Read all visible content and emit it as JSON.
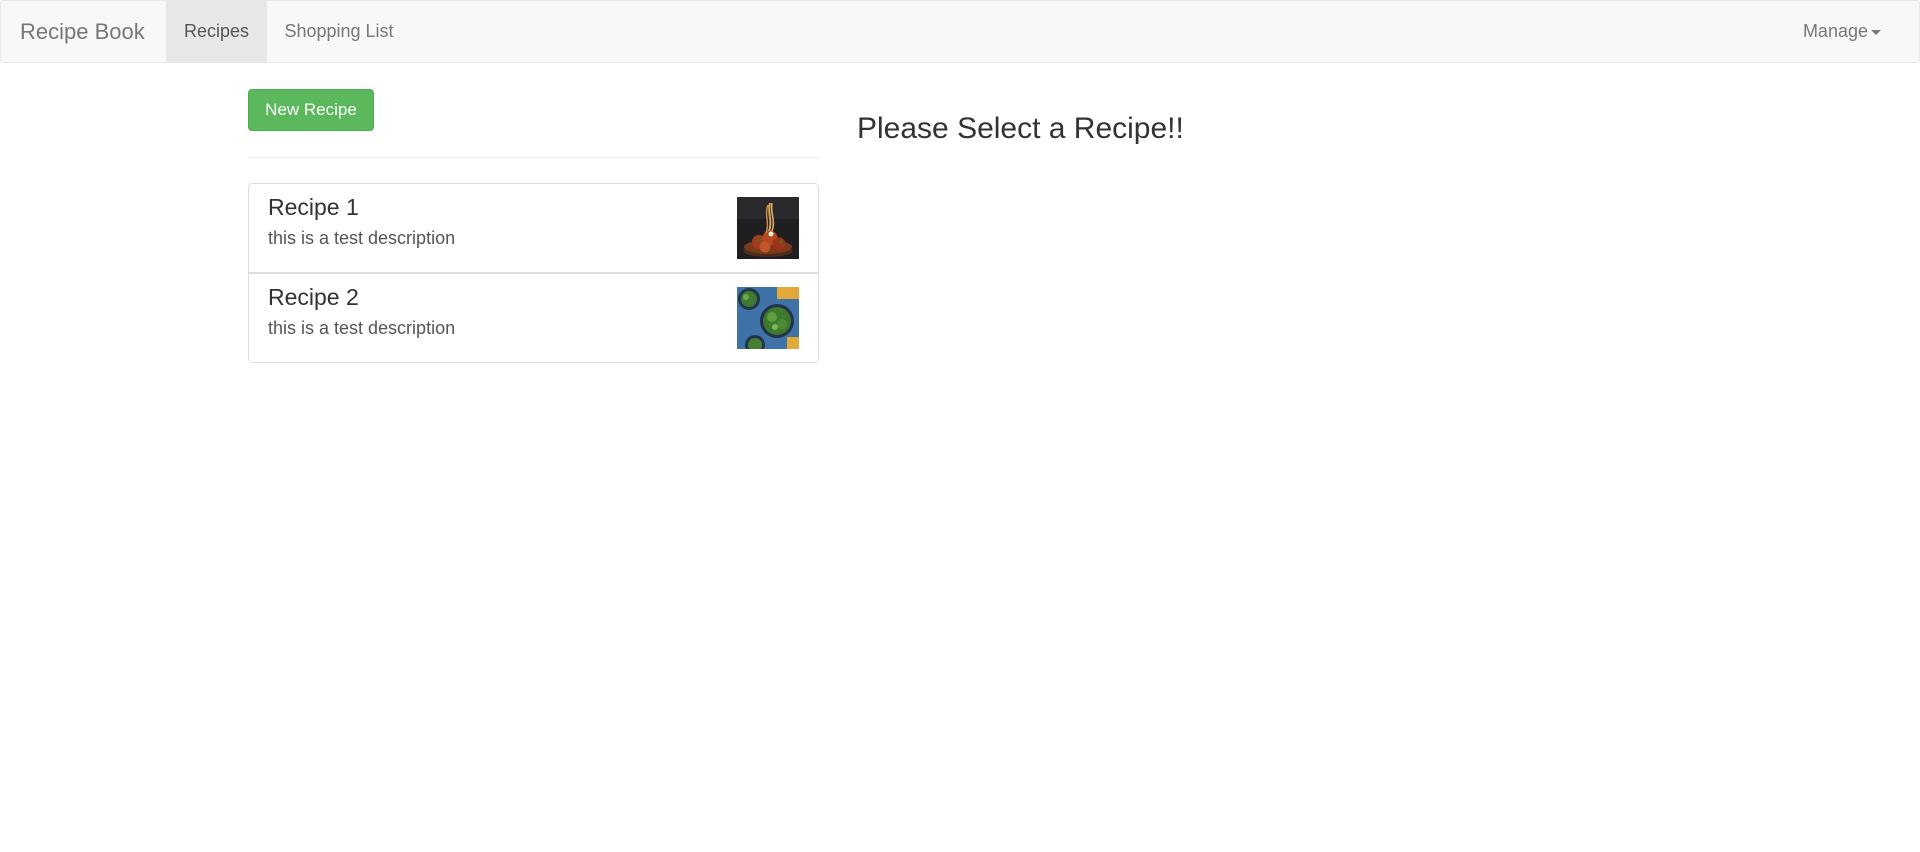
{
  "navbar": {
    "brand": "Recipe Book",
    "tabs": [
      {
        "label": "Recipes",
        "active": true
      },
      {
        "label": "Shopping List",
        "active": false
      }
    ],
    "manage_label": "Manage"
  },
  "actions": {
    "new_recipe_label": "New Recipe"
  },
  "recipes": [
    {
      "name": "Recipe 1",
      "description": "this is a test description",
      "image_icon": "pasta-dish-photo"
    },
    {
      "name": "Recipe 2",
      "description": "this is a test description",
      "image_icon": "salad-bowls-photo"
    }
  ],
  "detail": {
    "prompt": "Please Select a Recipe!!"
  },
  "colors": {
    "navbar_bg": "#f8f8f8",
    "active_tab_bg": "#e7e7e7",
    "success_button": "#5cb85c"
  }
}
